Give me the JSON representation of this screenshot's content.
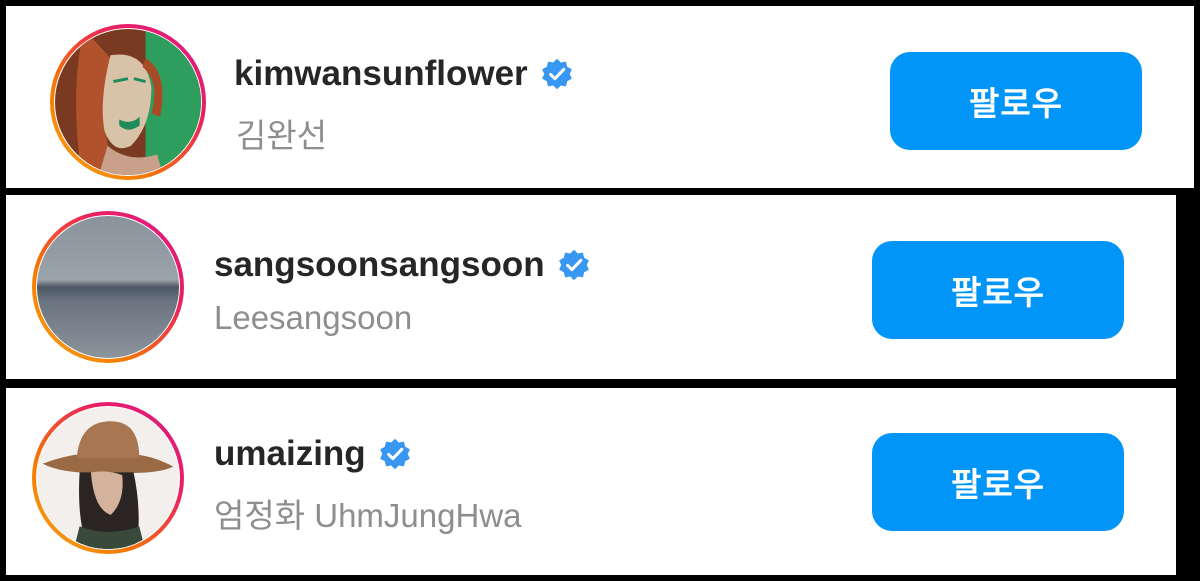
{
  "accent_color": "#0095f6",
  "verified_badge_color": "#3897f0",
  "suggestions": [
    {
      "username": "kimwansunflower",
      "full_name": "김완선",
      "verified": true,
      "avatar_icon": "painted-portrait-avatar",
      "follow_label": "팔로우"
    },
    {
      "username": "sangsoonsangsoon",
      "full_name": "Leesangsoon",
      "verified": true,
      "avatar_icon": "sea-horizon-avatar",
      "follow_label": "팔로우"
    },
    {
      "username": "umaizing",
      "full_name": "엄정화 UhmJungHwa",
      "verified": true,
      "avatar_icon": "cowboy-hat-portrait-avatar",
      "follow_label": "팔로우"
    }
  ]
}
